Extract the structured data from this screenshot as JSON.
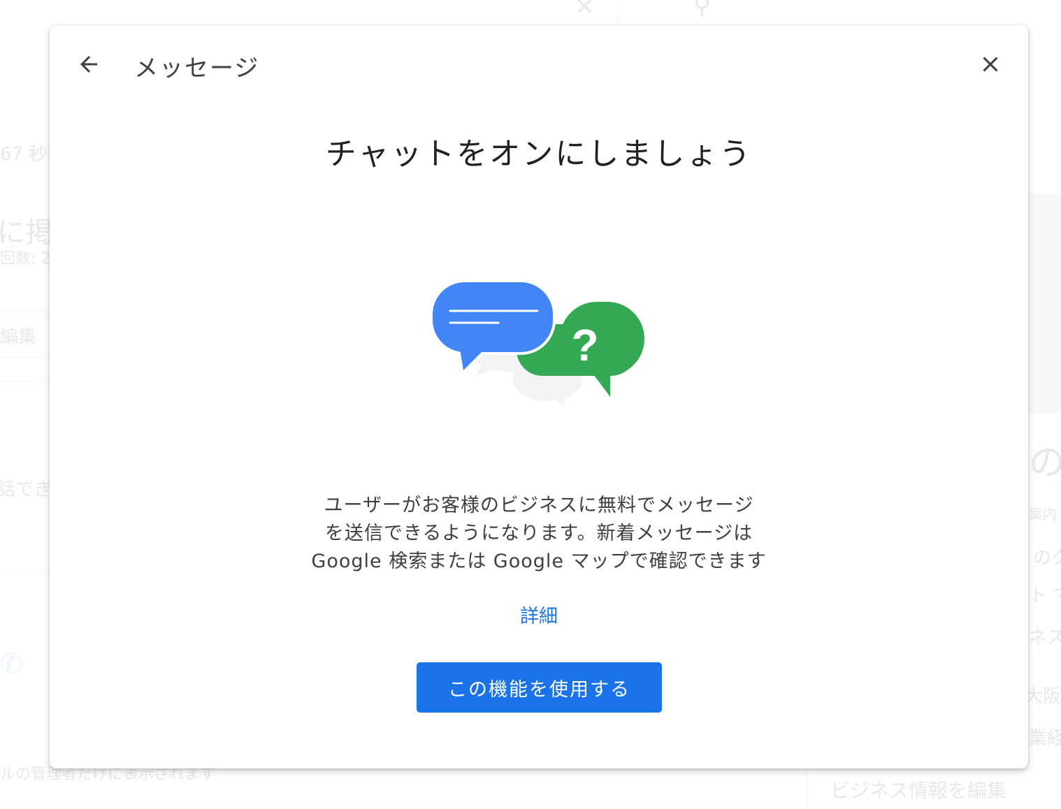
{
  "background": {
    "left_fragments": [
      "67 秒",
      "に掲載",
      "回数: 2",
      "編集",
      "話でき",
      "ルの管理者だけに表示されます"
    ],
    "right_fragments": [
      "の相",
      "案内",
      "のク",
      "ト マ",
      "ネス",
      "大阪",
      "業経",
      "ビジネス情報を編集"
    ]
  },
  "dialog": {
    "title": "メッセージ",
    "heading": "チャットをオンにしましょう",
    "description_lines": [
      "ユーザーがお客様のビジネスに無料でメッセージ",
      "を送信できるようになります。新着メッセージは",
      "Google 検索または Google マップで確認できます"
    ],
    "details_link": "詳細",
    "primary_button": "この機能を使用する"
  },
  "icons": {
    "back": "arrow-left-icon",
    "close": "close-icon",
    "illustration": "chat-bubbles-illustration"
  },
  "colors": {
    "primary": "#1a73e8",
    "bubble_blue": "#4285f4",
    "bubble_green": "#34a853",
    "bubble_grey": "#f1f3f4"
  }
}
